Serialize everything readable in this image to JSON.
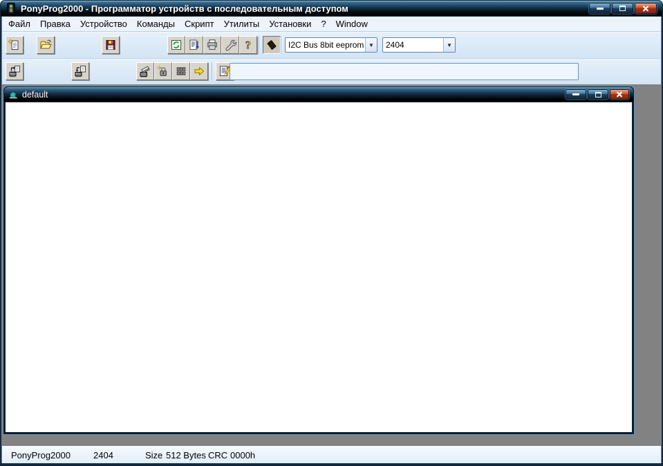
{
  "window": {
    "title": "PonyProg2000 - Программатор устройств с последовательным доступом",
    "controls": [
      "minimize",
      "maximize",
      "close"
    ]
  },
  "menubar": {
    "items": [
      "Файл",
      "Правка",
      "Устройство",
      "Команды",
      "Скрипт",
      "Утилиты",
      "Установки",
      "?",
      "Window"
    ]
  },
  "toolbar1": {
    "buttons": [
      "new-file-icon",
      "open-file-icon",
      "save-file-icon",
      "reload-icon",
      "script-icon",
      "print-icon",
      "setup-icon",
      "help-icon",
      "sprog-chip-icon"
    ],
    "device_family": "I2C Bus 8bit eeprom",
    "device_type": "2404"
  },
  "toolbar2": {
    "buttons": [
      "read-device-icon",
      "write-device-icon",
      "erase-device-icon",
      "lock-icon",
      "security-bits-icon",
      "run-icon",
      "edit-note-icon"
    ],
    "note_value": ""
  },
  "child_window": {
    "title": "default",
    "controls": [
      "minimize",
      "maximize",
      "close"
    ]
  },
  "statusbar": {
    "app_name": "PonyProg2000",
    "device": "2404",
    "size_label": "Size",
    "size_value": "512 Bytes",
    "crc_label": "CRC",
    "crc_value": "0000h"
  },
  "colors": {
    "titlebar_top": "#8cbcd6",
    "titlebar_bottom": "#000000",
    "close_button": "#c23a1e",
    "toolbar_bg": "#d9e7f6",
    "mdi_bg": "#828282",
    "statusbar_bg": "#e7f1fb",
    "frame_accent": "#5d89ab"
  }
}
